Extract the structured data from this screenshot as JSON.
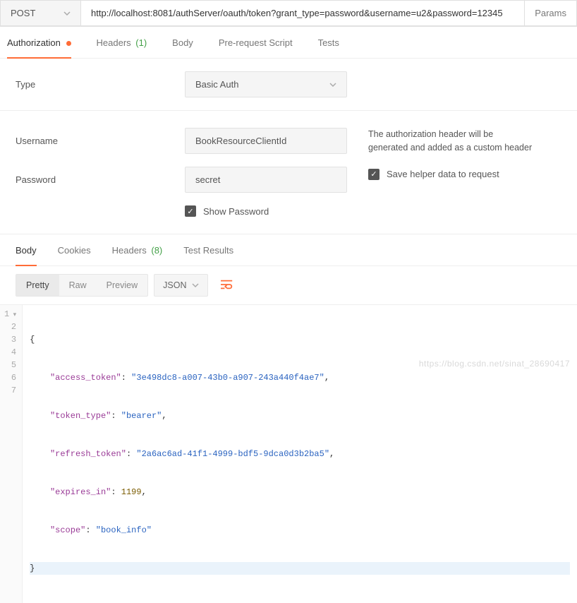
{
  "request": {
    "method": "POST",
    "url": "http://localhost:8081/authServer/oauth/token?grant_type=password&username=u2&password=12345",
    "params_label": "Params"
  },
  "tabs": {
    "authorization": "Authorization",
    "headers": "Headers",
    "headers_count": "(1)",
    "body": "Body",
    "prerequest": "Pre-request Script",
    "tests": "Tests"
  },
  "auth": {
    "type_label": "Type",
    "type_value": "Basic Auth",
    "username_label": "Username",
    "username_value": "BookResourceClientId",
    "password_label": "Password",
    "password_value": "secret",
    "show_password": "Show Password",
    "help_text1": "The authorization header will be",
    "help_text2": "generated and added as a custom header",
    "save_helper": "Save helper data to request"
  },
  "response": {
    "tabs": {
      "body": "Body",
      "cookies": "Cookies",
      "headers": "Headers",
      "headers_count": "(8)",
      "tests": "Test Results"
    },
    "view": {
      "pretty": "Pretty",
      "raw": "Raw",
      "preview": "Preview",
      "format": "JSON"
    }
  },
  "json_body": {
    "access_token_key": "\"access_token\"",
    "access_token_val": "\"3e498dc8-a007-43b0-a907-243a440f4ae7\"",
    "token_type_key": "\"token_type\"",
    "token_type_val": "\"bearer\"",
    "refresh_token_key": "\"refresh_token\"",
    "refresh_token_val": "\"2a6ac6ad-41f1-4999-bdf5-9dca0d3b2ba5\"",
    "expires_in_key": "\"expires_in\"",
    "expires_in_val": "1199",
    "scope_key": "\"scope\"",
    "scope_val": "\"book_info\""
  },
  "watermark": "https://blog.csdn.net/sinat_28690417"
}
